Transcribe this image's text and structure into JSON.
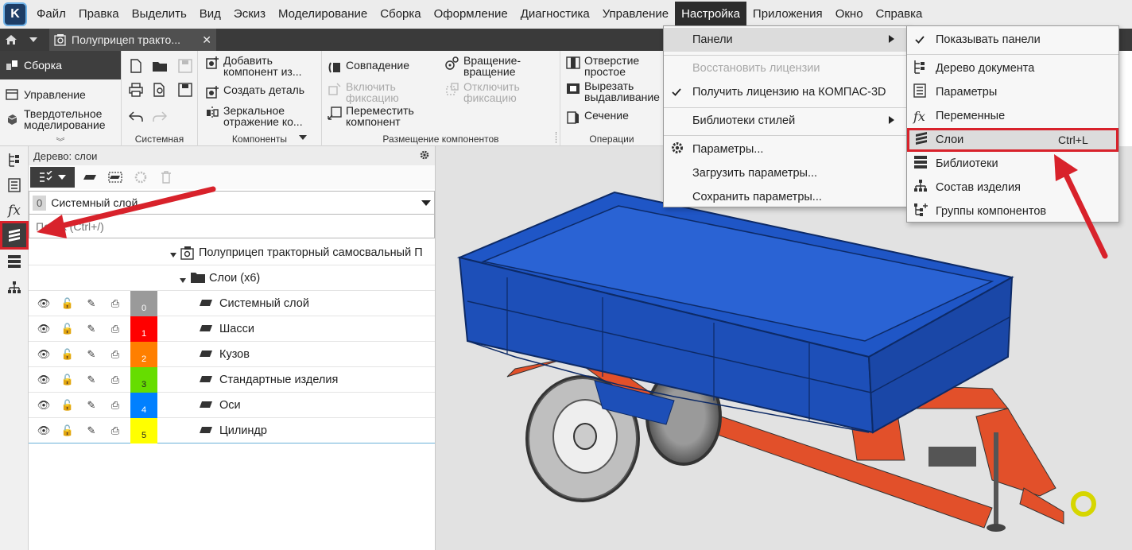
{
  "menubar": {
    "logo": "K",
    "items": [
      "Файл",
      "Правка",
      "Выделить",
      "Вид",
      "Эскиз",
      "Моделирование",
      "Сборка",
      "Оформление",
      "Диагностика",
      "Управление",
      "Настройка",
      "Приложения",
      "Окно",
      "Справка"
    ],
    "active": "Настройка"
  },
  "tabbar": {
    "doc_title": "Полуприцеп тракто...",
    "close": "✕"
  },
  "ribbon": {
    "modes": {
      "assembly": "Сборка",
      "management": "Управление",
      "solid_line1": "Твердотельное",
      "solid_line2": "моделирование",
      "more": "︾"
    },
    "groups": {
      "system": "Системная",
      "components": "Компоненты",
      "placement": "Размещение компонентов",
      "operations": "Операции"
    },
    "buttons": {
      "add_component_1": "Добавить",
      "add_component_2": "компонент из...",
      "create_part": "Создать деталь",
      "mirror_1": "Зеркальное",
      "mirror_2": "отражение ко...",
      "coincidence": "Совпадение",
      "enable_fix_1": "Включить",
      "enable_fix_2": "фиксацию",
      "move_comp_1": "Переместить",
      "move_comp_2": "компонент",
      "rotation_1": "Вращение-",
      "rotation_2": "вращение",
      "disable_fix_1": "Отключить",
      "disable_fix_2": "фиксацию",
      "hole_1": "Отверстие",
      "hole_2": "простое",
      "extrude_cut_1": "Вырезать",
      "extrude_cut_2": "выдавливание",
      "section": "Сечение"
    }
  },
  "tree_panel": {
    "header": "Дерево: слои",
    "layer_select": {
      "number": "0",
      "name": "Системный слой"
    },
    "search_placeholder": "Поиск (Ctrl+/)",
    "root": "Полуприцеп тракторный самосвальный П",
    "layers_folder": "Слои (х6)",
    "layers": [
      {
        "num": "0",
        "name": "Системный слой",
        "color": "#9a9a9a"
      },
      {
        "num": "1",
        "name": "Шасси",
        "color": "#ff0000"
      },
      {
        "num": "2",
        "name": "Кузов",
        "color": "#ff7f00"
      },
      {
        "num": "3",
        "name": "Стандартные изделия",
        "color": "#66dd00"
      },
      {
        "num": "4",
        "name": "Оси",
        "color": "#0080ff"
      },
      {
        "num": "5",
        "name": "Цилиндр",
        "color": "#ffff00"
      }
    ]
  },
  "menu_settings": {
    "panels": "Панели",
    "restore_license": "Восстановить лицензии",
    "get_license": "Получить лицензию на КОМПАС-3D",
    "style_libraries": "Библиотеки стилей",
    "parameters": "Параметры...",
    "load_parameters": "Загрузить параметры...",
    "save_parameters": "Сохранить параметры..."
  },
  "menu_panels": {
    "show_panels": "Показывать панели",
    "document_tree": "Дерево документа",
    "parameters": "Параметры",
    "variables": "Переменные",
    "layers": "Слои",
    "layers_shortcut": "Ctrl+L",
    "libraries": "Библиотеки",
    "product_structure": "Состав изделия",
    "component_groups": "Группы компонентов"
  },
  "colors": {
    "accent_red": "#d8222b",
    "body_blue": "#1f56c6",
    "frame_orange": "#e2502a"
  }
}
